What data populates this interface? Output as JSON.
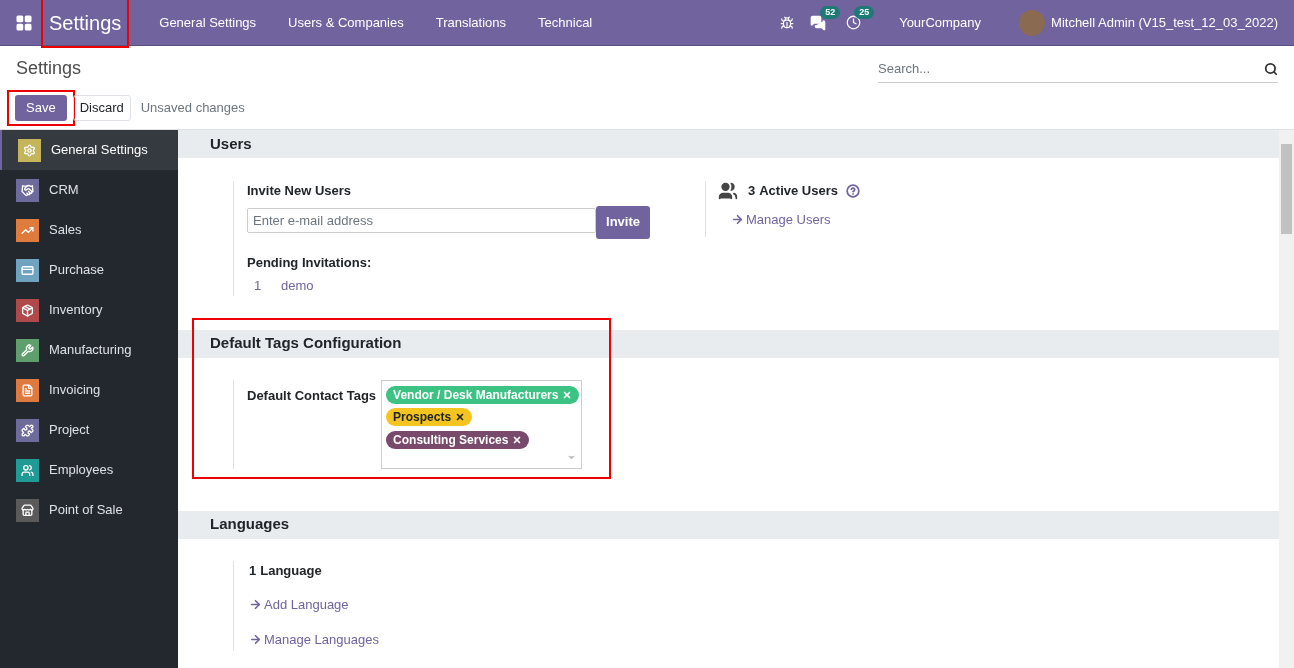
{
  "navbar": {
    "brand": "Settings",
    "brand_highlighted": true,
    "menu": [
      "General Settings",
      "Users & Companies",
      "Translations",
      "Technical"
    ],
    "messages_count": "52",
    "activities_count": "25",
    "company": "YourCompany",
    "user": "Mitchell Admin (V15_test_12_03_2022)"
  },
  "control_panel": {
    "title": "Settings",
    "search": {
      "placeholder": "Search..."
    },
    "save": "Save",
    "save_highlighted": true,
    "discard": "Discard",
    "status": "Unsaved changes"
  },
  "sidebar": {
    "items": [
      {
        "label": "General Settings",
        "selected": true,
        "color": "#c4b45a"
      },
      {
        "label": "CRM",
        "selected": false,
        "color": "#6d6a9c"
      },
      {
        "label": "Sales",
        "selected": false,
        "color": "#e07b3e"
      },
      {
        "label": "Purchase",
        "selected": false,
        "color": "#6fa3c0"
      },
      {
        "label": "Inventory",
        "selected": false,
        "color": "#b04a4a"
      },
      {
        "label": "Manufacturing",
        "selected": false,
        "color": "#5e9f6d"
      },
      {
        "label": "Invoicing",
        "selected": false,
        "color": "#de7a40"
      },
      {
        "label": "Project",
        "selected": false,
        "color": "#6d6a9c"
      },
      {
        "label": "Employees",
        "selected": false,
        "color": "#1f9a94"
      },
      {
        "label": "Point of Sale",
        "selected": false,
        "color": "#5a5a5a"
      }
    ]
  },
  "users": {
    "title": "Users",
    "invite_label": "Invite New Users",
    "email_placeholder": "Enter e-mail address",
    "invite_button": "Invite",
    "pending_label": "Pending Invitations:",
    "pending": [
      {
        "count": "1",
        "name": "demo"
      }
    ],
    "active_count": "3",
    "active_label": "Active Users",
    "manage_link": "Manage Users"
  },
  "tags": {
    "title": "Default Tags Configuration",
    "highlighted": true,
    "label": "Default Contact Tags",
    "items": [
      {
        "label": "Vendor / Desk Manufacturers",
        "color": "#3cc283"
      },
      {
        "label": "Prospects",
        "color": "#f4c521"
      },
      {
        "label": "Consulting Services",
        "color": "#7a4a6c"
      }
    ]
  },
  "languages": {
    "title": "Languages",
    "count": "1",
    "count_label": "Language",
    "links": [
      "Add Language",
      "Manage Languages"
    ]
  }
}
